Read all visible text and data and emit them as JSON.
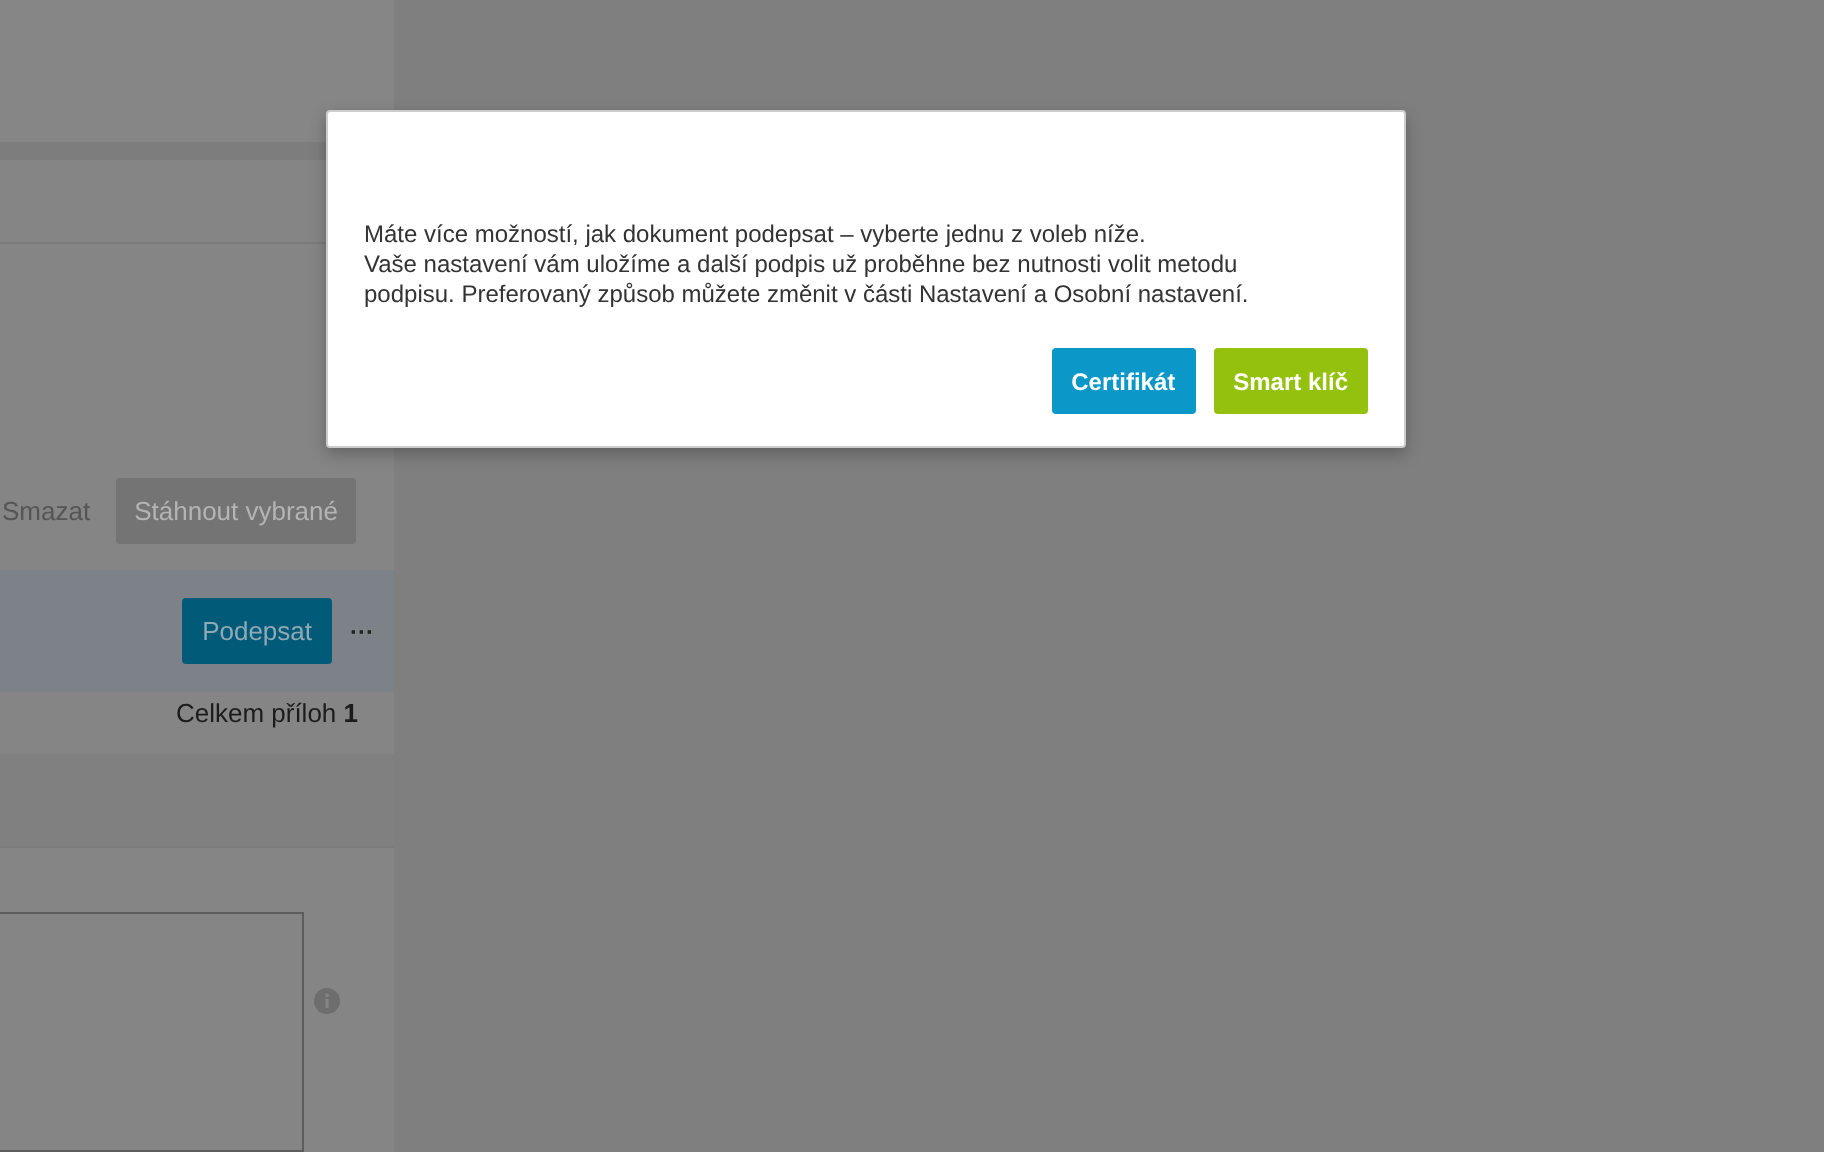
{
  "background": {
    "toolbar": {
      "delete_label": "Smazat",
      "download_button": {
        "label": "Stáhnout vybrané",
        "disabled": true
      }
    },
    "document_row": {
      "sign_button": "Podepsat",
      "more": "···"
    },
    "attachments_total": "Celkem příloh **1**"
  },
  "dialog": {
    "paragraphs": [
      "Máte více možností, jak dokument podepsat – vyberte jednu z voleb níže.",
      "Vaše nastavení vám uložíme a další podpis už proběhne bez nutnosti volit metodu podpisu. Preferovaný způsob můžete změnit v části Nastavení a Osobní nastavení."
    ],
    "buttons": [
      {
        "label": "Certifikát",
        "kind": "primary"
      },
      {
        "label": "Smart klíč",
        "kind": "success"
      }
    ]
  }
}
